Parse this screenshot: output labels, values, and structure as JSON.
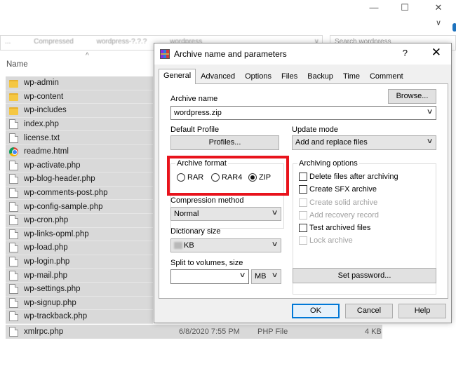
{
  "explorer": {
    "window_controls": {
      "minimize": "—",
      "maximize": "☐",
      "close": "✕",
      "chevron": "∨"
    },
    "address_segments": [
      "...",
      "Compressed",
      "wordpress-?.?.?",
      "wordpress"
    ],
    "address_dropdown": "∨",
    "search_placeholder": "Search wordpress",
    "column_name": "Name",
    "sort_indicator": "^",
    "files": [
      {
        "name": "wp-admin",
        "icon": "folder-icon"
      },
      {
        "name": "wp-content",
        "icon": "folder-icon"
      },
      {
        "name": "wp-includes",
        "icon": "folder-icon"
      },
      {
        "name": "index.php",
        "icon": "document-icon"
      },
      {
        "name": "license.txt",
        "icon": "document-icon"
      },
      {
        "name": "readme.html",
        "icon": "chrome-icon"
      },
      {
        "name": "wp-activate.php",
        "icon": "document-icon"
      },
      {
        "name": "wp-blog-header.php",
        "icon": "document-icon"
      },
      {
        "name": "wp-comments-post.php",
        "icon": "document-icon"
      },
      {
        "name": "wp-config-sample.php",
        "icon": "document-icon"
      },
      {
        "name": "wp-cron.php",
        "icon": "document-icon"
      },
      {
        "name": "wp-links-opml.php",
        "icon": "document-icon"
      },
      {
        "name": "wp-load.php",
        "icon": "document-icon"
      },
      {
        "name": "wp-login.php",
        "icon": "document-icon"
      },
      {
        "name": "wp-mail.php",
        "icon": "document-icon"
      },
      {
        "name": "wp-settings.php",
        "icon": "document-icon"
      },
      {
        "name": "wp-signup.php",
        "icon": "document-icon"
      },
      {
        "name": "wp-trackback.php",
        "icon": "document-icon"
      }
    ],
    "last_file": {
      "name": "xmlrpc.php",
      "date": "6/8/2020 7:55 PM",
      "type": "PHP File",
      "size": "4 KB"
    }
  },
  "dialog": {
    "title": "Archive name and parameters",
    "help": "?",
    "close": "✕",
    "tabs": [
      "General",
      "Advanced",
      "Options",
      "Files",
      "Backup",
      "Time",
      "Comment"
    ],
    "archive_name_label": "Archive name",
    "browse_button": "Browse...",
    "archive_name_value": "wordpress.zip",
    "default_profile_label": "Default Profile",
    "profiles_button": "Profiles...",
    "update_mode_label": "Update mode",
    "update_mode_value": "Add and replace files",
    "archive_format_label": "Archive format",
    "formats": [
      "RAR",
      "RAR4",
      "ZIP"
    ],
    "selected_format": "ZIP",
    "archiving_options_label": "Archiving options",
    "options": [
      {
        "label": "Delete files after archiving",
        "enabled": true,
        "checked": false
      },
      {
        "label": "Create SFX archive",
        "enabled": true,
        "checked": false
      },
      {
        "label": "Create solid archive",
        "enabled": false,
        "checked": false
      },
      {
        "label": "Add recovery record",
        "enabled": false,
        "checked": false
      },
      {
        "label": "Test archived files",
        "enabled": true,
        "checked": false
      },
      {
        "label": "Lock archive",
        "enabled": false,
        "checked": false
      }
    ],
    "compression_method_label": "Compression method",
    "compression_method_value": "Normal",
    "dictionary_size_label": "Dictionary size",
    "dictionary_size_value": "KB",
    "split_label": "Split to volumes, size",
    "split_value": "",
    "split_unit": "MB",
    "set_password_button": "Set password...",
    "ok_button": "OK",
    "cancel_button": "Cancel",
    "help_button": "Help",
    "dropdown_glyph": "∨",
    "highlight_color": "#e8131c"
  }
}
